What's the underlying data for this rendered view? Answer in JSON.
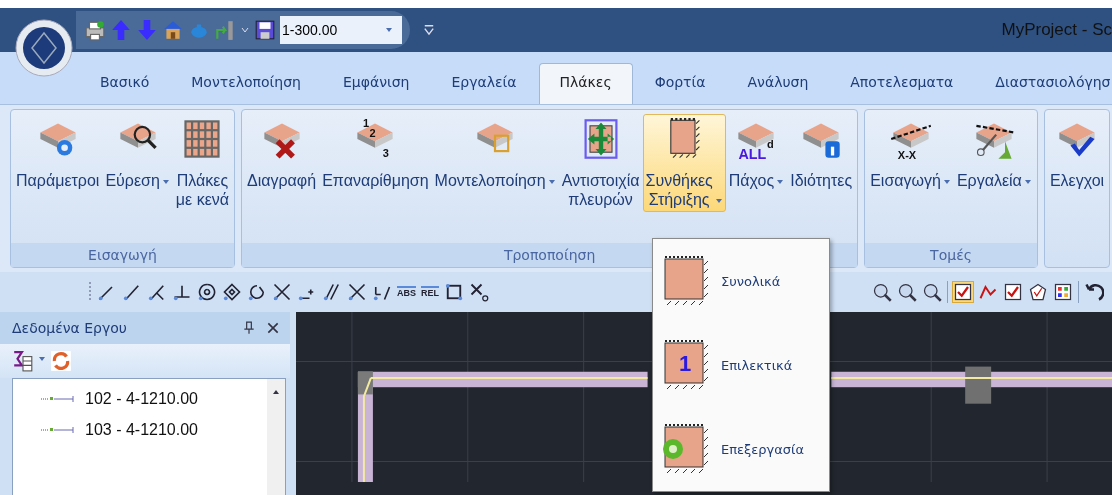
{
  "quick_access": {
    "scale": "1-300.00"
  },
  "window": {
    "title": "MyProject - Sc"
  },
  "tabs": [
    {
      "label": "Βασικό",
      "selected": false
    },
    {
      "label": "Μοντελοποίηση",
      "selected": false
    },
    {
      "label": "Εμφάνιση",
      "selected": false
    },
    {
      "label": "Εργαλεία",
      "selected": false
    },
    {
      "label": "Πλάκες",
      "selected": true
    },
    {
      "label": "Φορτία",
      "selected": false
    },
    {
      "label": "Ανάλυση",
      "selected": false
    },
    {
      "label": "Αποτελεσματα",
      "selected": false
    },
    {
      "label": "Διαστασιολόγησ",
      "selected": false
    }
  ],
  "ribbon_groups": [
    {
      "label": "Εισαγωγή",
      "buttons": [
        {
          "lines": [
            "Παράμετροι"
          ],
          "dropdown": false,
          "selected": false
        },
        {
          "lines": [
            "Εύρεση"
          ],
          "dropdown": true,
          "selected": false
        },
        {
          "lines": [
            "Πλάκες",
            "με κενά"
          ],
          "dropdown": false,
          "selected": false
        }
      ]
    },
    {
      "label": "Τροποποίηση",
      "buttons": [
        {
          "lines": [
            "Διαγραφή"
          ],
          "dropdown": false,
          "selected": false
        },
        {
          "lines": [
            "Επαναρίθμηση"
          ],
          "dropdown": false,
          "selected": false,
          "icon_text": [
            "1",
            "2",
            "3"
          ]
        },
        {
          "lines": [
            "Μοντελοποίηση"
          ],
          "dropdown": true,
          "selected": false
        },
        {
          "lines": [
            "Αντιστοιχία",
            "πλευρών"
          ],
          "dropdown": false,
          "selected": false
        },
        {
          "lines": [
            "Συνθήκες",
            "Στήριξης"
          ],
          "dropdown": true,
          "selected": true
        },
        {
          "lines": [
            "Πάχος"
          ],
          "dropdown": true,
          "selected": false,
          "icon_text": [
            "ALL",
            "d"
          ]
        },
        {
          "lines": [
            "Ιδιότητες"
          ],
          "dropdown": false,
          "selected": false
        }
      ]
    },
    {
      "label": "Τομές",
      "buttons": [
        {
          "lines": [
            "Εισαγωγή"
          ],
          "dropdown": true,
          "selected": false,
          "icon_text": [
            "X-X"
          ]
        },
        {
          "lines": [
            "Εργαλεία"
          ],
          "dropdown": true,
          "selected": false
        }
      ]
    },
    {
      "buttons": [
        {
          "lines": [
            "Ελεγχοι"
          ],
          "dropdown": false,
          "selected": false
        }
      ]
    }
  ],
  "toolbar": {
    "icon_labels": [
      "ABS",
      "REL"
    ]
  },
  "panel": {
    "title": "Δεδομένα Εργου",
    "items": [
      {
        "label": "102 - 4-1210.00"
      },
      {
        "label": "103 - 4-1210.00"
      }
    ]
  },
  "menu": {
    "items": [
      {
        "label": "Συνολικά"
      },
      {
        "label": "Επιλεκτικά",
        "icon_text": "1"
      },
      {
        "label": "Επεξεργασία"
      }
    ]
  }
}
